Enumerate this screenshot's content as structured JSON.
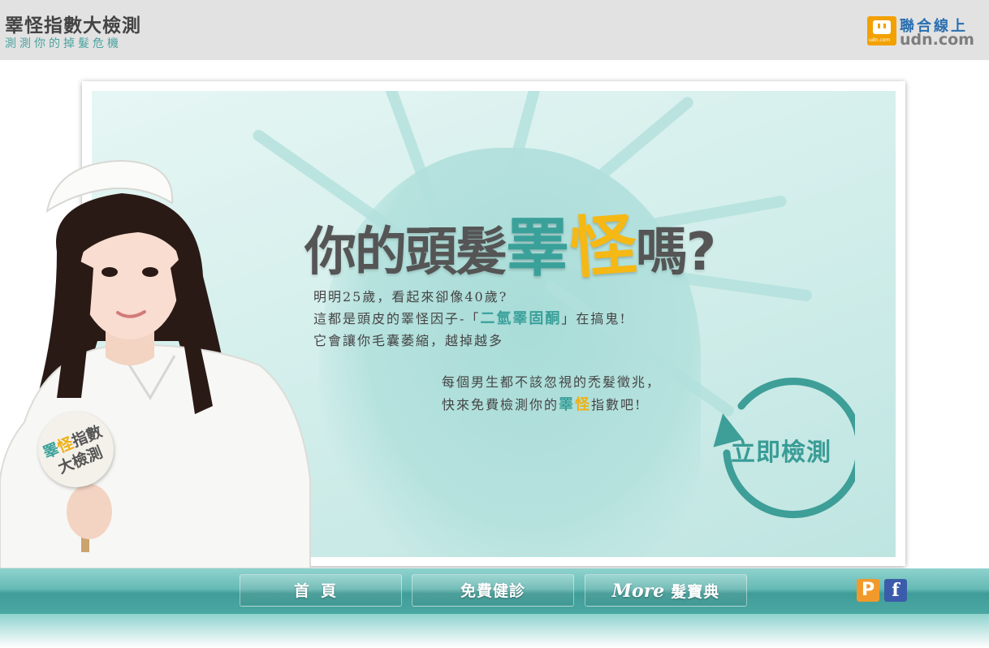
{
  "header": {
    "title": "睪怪指數大檢測",
    "subtitle": "測測你的掉髮危機",
    "logo": {
      "chinese": "聯合線上",
      "english": "udn.com",
      "badge": "udn.com"
    }
  },
  "hero": {
    "headline_pre": "你的頭髮",
    "headline_teal": "睪",
    "headline_yellow": "怪",
    "headline_post": "嗎?",
    "line1": "明明25歲，看起來卻像40歲?",
    "line2_pre": "這都是頭皮的睪怪因子-「",
    "line2_highlight": "二氫睪固酮",
    "line2_post": "」在搞鬼!",
    "line3": "它會讓你毛囊萎縮，越掉越多",
    "line4": "每個男生都不該忽視的禿髮徵兆，",
    "line5_pre": "快來免費檢測你的",
    "line5_teal": "睪",
    "line5_yellow": "怪",
    "line5_post": "指數吧!",
    "cta_label": "立即檢測"
  },
  "sign": {
    "teal": "睪",
    "yellow": "怪",
    "rest": "指數",
    "line2": "大檢測"
  },
  "nav": {
    "home": "首頁",
    "free_check": "免費健診",
    "more_script": "More",
    "more_rest": "髮寶典"
  },
  "social": {
    "plurk": "P",
    "facebook": "f"
  },
  "colors": {
    "teal": "#3aa09a",
    "yellow": "#f6b814",
    "header_bg": "#e2e2e2",
    "nav": "#4ba7a2"
  }
}
